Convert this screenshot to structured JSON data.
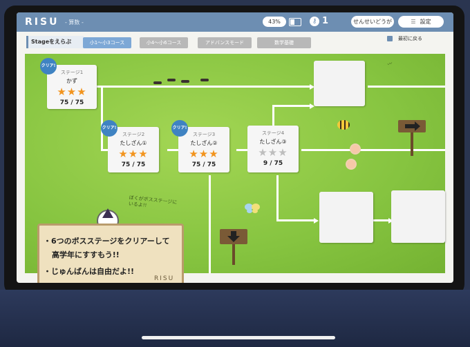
{
  "topbar": {
    "logo": "RISU",
    "subject": "- 算数 -",
    "battery_percent": "43%",
    "key_count": "1",
    "teacher_button": "せんせいどうが",
    "settings_button": "設定"
  },
  "tabs": {
    "title": "Stageをえらぶ",
    "items": [
      {
        "label": "小1〜小3コース",
        "active": true
      },
      {
        "label": "小4〜小6コース",
        "active": false
      },
      {
        "label": "アドバンスモード",
        "active": false
      },
      {
        "label": "数学基礎",
        "active": false
      }
    ],
    "back_label": "最初に戻る"
  },
  "stages": [
    {
      "number": "ステージ1",
      "name": "かず",
      "stars_earned": 3,
      "stars_total": 3,
      "score": "75 / 75",
      "badge": "クリア!"
    },
    {
      "number": "ステージ2",
      "name": "たしざん①",
      "stars_earned": 3,
      "stars_total": 3,
      "score": "75 / 75",
      "badge": "クリア!"
    },
    {
      "number": "ステージ3",
      "name": "たしざん②",
      "stars_earned": 3,
      "stars_total": 3,
      "score": "75 / 75",
      "badge": "クリア!"
    },
    {
      "number": "ステージ4",
      "name": "たしざん③",
      "stars_earned": 0,
      "stars_total": 3,
      "score": "9 / 75",
      "badge": ""
    }
  ],
  "board": {
    "line1": "・6つのボスステージをクリアーして",
    "line2": "高学年にすすもう!!",
    "line3": "・じゅんばんは自由だよ!!",
    "logo": "RISU"
  },
  "note": "ぼくがボスステージにいるよ!!",
  "colors": {
    "topbar": "#6d8eb2",
    "active_tab": "#7da8d6",
    "star_on": "#f2941e",
    "star_off": "#bdbdbd",
    "clear_badge": "#3f83c2",
    "grass": "#86c440"
  }
}
